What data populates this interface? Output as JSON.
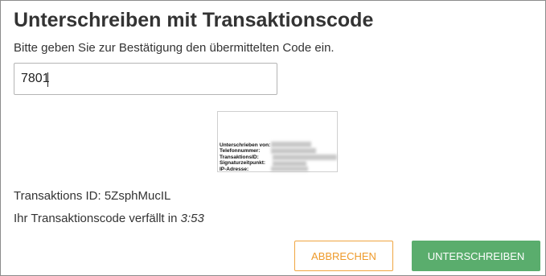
{
  "dialog": {
    "title": "Unterschreiben mit Transaktionscode",
    "instruction": "Bitte geben Sie zur Bestätigung den übermittelten Code ein."
  },
  "code_field": {
    "value": "7801"
  },
  "signature_preview": {
    "labels": [
      "Unterschrieben von:",
      "Telefonnummer:",
      "TransaktionsID:",
      "Signaturzeitpunkt:",
      "IP-Adresse:"
    ]
  },
  "transaction": {
    "id_text": "Transaktions ID: 5ZsphMucIL",
    "expiry_prefix": "Ihr Transaktionscode verfällt in ",
    "expiry_time": "3:53"
  },
  "buttons": {
    "cancel_label": "ABBRECHEN",
    "sign_label": "UNTERSCHREIBEN"
  },
  "colors": {
    "cancel_accent": "#ee9a2a",
    "sign_background": "#5aad6d",
    "text": "#333333"
  }
}
